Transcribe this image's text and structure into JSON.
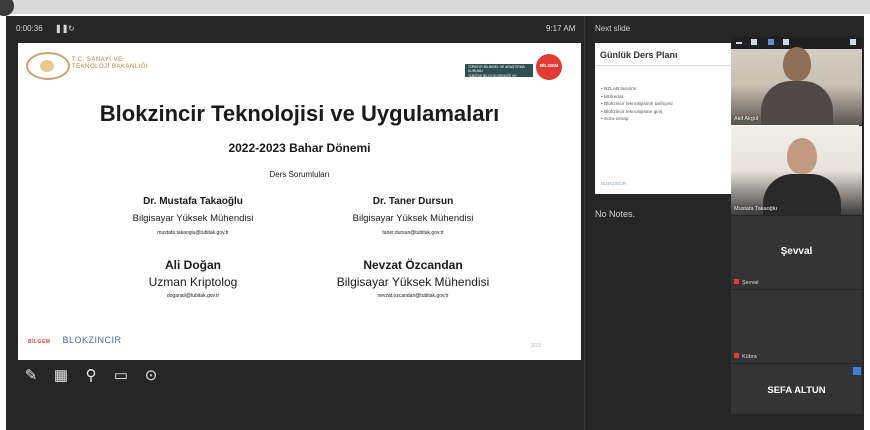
{
  "presenter": {
    "timer": "0:00:36",
    "pause_icon": "pause-icon",
    "reset_icon": "reset-icon",
    "clock": "9:17 AM",
    "next_slide_label": "Next slide",
    "notes": "No Notes."
  },
  "slide": {
    "ministry": [
      "T.C. SANAYİ VE",
      "TEKNOLOJİ BAKANLIĞI"
    ],
    "institute": [
      "TÜRKİYE BİLİMSEL VE ARAŞTIRMA KURUMU",
      "TÜBİTAK BİLGİ GÜVENLİĞİ VE",
      "İLERİ TEKNOLOJİLER ARAŞTIRMA MERKEZİ"
    ],
    "bilgem": "BİLGEM",
    "title": "Blokzincir Teknolojisi ve Uygulamaları",
    "subtitle": "2022-2023 Bahar Dönemi",
    "responsibles_label": "Ders Sorumluları",
    "people": [
      {
        "name": "Dr. Mustafa Takaoğlu",
        "title": "Bilgisayar Yüksek Mühendisi",
        "email": "mustafa.takaoglu@tubitak.gov.tr"
      },
      {
        "name": "Dr. Taner Dursun",
        "title": "Bilgisayar Yüksek Mühendisi",
        "email": "taner.dursun@tubitak.gov.tr"
      },
      {
        "name": "Ali Doğan",
        "title": "Uzman Kriptolog",
        "email": "doganali@tubitak.gov.tr"
      },
      {
        "name": "Nevzat Özcandan",
        "title": "Bilgisayar Yüksek Mühendisi",
        "email": "nevzat.ozcandan@tubitak.gov.tr"
      }
    ],
    "footer_logo": "BLOKZINCIR",
    "page": "2/33"
  },
  "next_slide": {
    "title": "Günlük Ders Planı",
    "items": [
      "BZLAB tanıtımı",
      "Müfredat",
      "Blokzincir teknolojisinin tarihçesi",
      "Blokzincir teknolojisine giriş",
      "Soru-cevap"
    ],
    "footer": "BLOKZINCIR"
  },
  "participants": [
    {
      "name": "Akif Akgül",
      "camera": true
    },
    {
      "name": "Mustafa Takaoğlu",
      "camera": true
    },
    {
      "name": "Şevval",
      "camera": false,
      "label": "Şevval"
    },
    {
      "name": "Kübra",
      "camera": false,
      "label": "Kübra"
    },
    {
      "name": "SEFA ALTUN",
      "camera": false
    }
  ],
  "tools": [
    "pen-icon",
    "slides-grid-icon",
    "zoom-icon",
    "screen-icon",
    "more-icon"
  ]
}
